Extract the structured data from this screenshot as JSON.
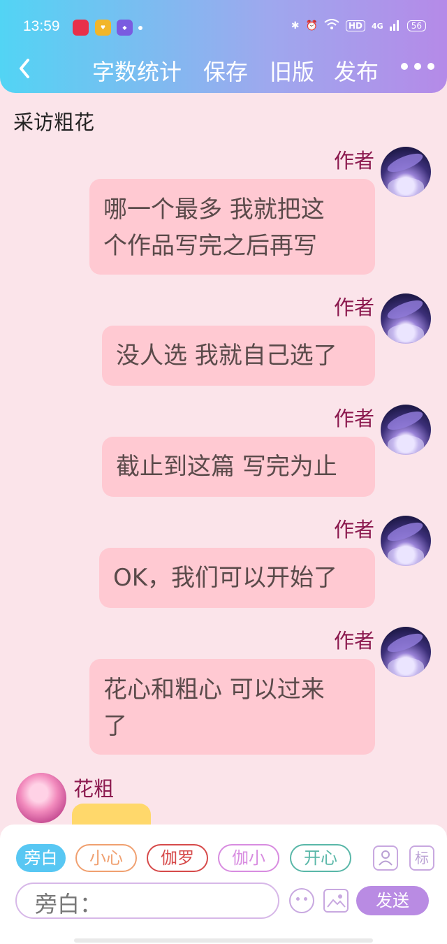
{
  "status_bar": {
    "time": "13:59",
    "hd": "HD",
    "net": "4G",
    "battery": "56"
  },
  "nav": {
    "items": [
      "字数统计",
      "保存",
      "旧版",
      "发布"
    ]
  },
  "page_title": "采访粗花",
  "messages": [
    {
      "author": "作者",
      "text": "哪一个最多 我就把这\n个作品写完之后再写"
    },
    {
      "author": "作者",
      "text": "没人选 我就自己选了"
    },
    {
      "author": "作者",
      "text": "截止到这篇 写完为止"
    },
    {
      "author": "作者",
      "text": "OK，我们可以开始了"
    },
    {
      "author": "作者",
      "text": "花心和粗心 可以过来\n了"
    }
  ],
  "left_message": {
    "author": "花粗"
  },
  "composer": {
    "chips": [
      {
        "label": "旁白",
        "color": "#58c7f3"
      },
      {
        "label": "小心",
        "color": "#f0a070"
      },
      {
        "label": "伽罗",
        "color": "#d64a4a"
      },
      {
        "label": "伽小",
        "color": "#d88ce0"
      },
      {
        "label": "开心",
        "color": "#59b7a8"
      }
    ],
    "tag_icon_label": "标",
    "input_placeholder": "旁白：",
    "send_label": "发送"
  }
}
